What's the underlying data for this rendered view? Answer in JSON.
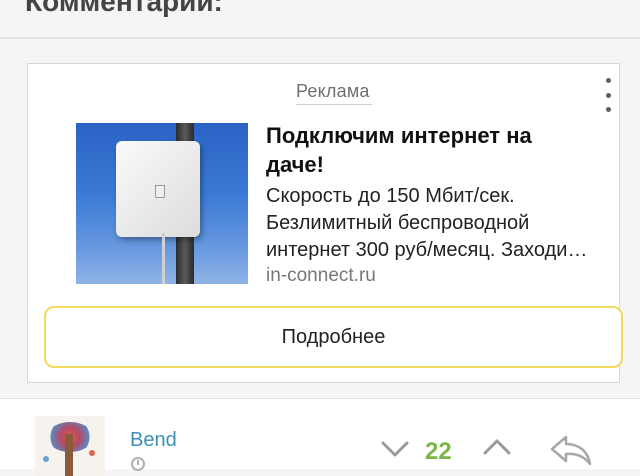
{
  "page": {
    "section_title": "Комментарии:"
  },
  "ad": {
    "label": "Реклама",
    "headline": "Подключим интернет на даче!",
    "text_lines": [
      "Скорость до 150 Мбит/сек.",
      "Безлимитный беспроводной",
      "интернет 300 руб/месяц. Заходи…"
    ],
    "domain": "in-connect.ru",
    "button_label": "Подробнее",
    "menu_icon": "more-vertical-icon",
    "image": "outdoor-antenna-on-pole"
  },
  "comment": {
    "username": "Bend",
    "rating": "22",
    "icons": {
      "time": "clock-icon",
      "down": "chevron-down-icon",
      "up": "chevron-up-icon",
      "reply": "reply-icon"
    }
  },
  "colors": {
    "username": "#3e8fb8",
    "rating_positive": "#7ab648",
    "button_border": "#f2da5c",
    "background": "#f5f5f5"
  }
}
